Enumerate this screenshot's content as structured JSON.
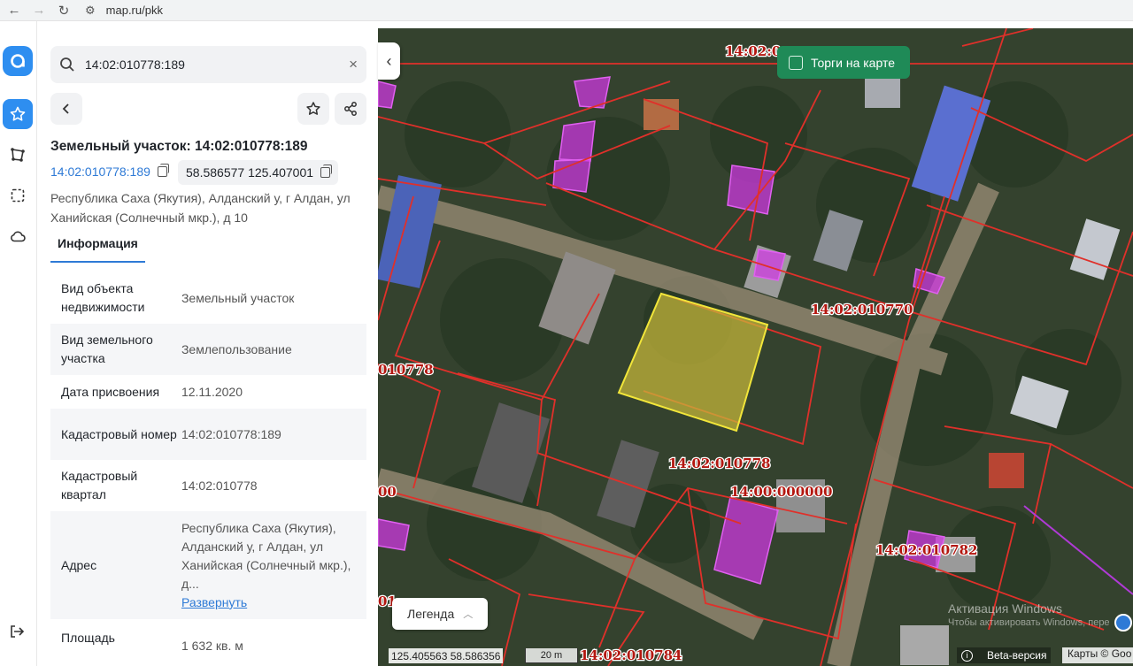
{
  "browser": {
    "url": "map.ru/pkk",
    "back_icon": "arrow-left-icon",
    "forward_icon": "arrow-right-icon",
    "reload_icon": "reload-icon",
    "site_icon": "tune-icon"
  },
  "rail": {
    "items": [
      {
        "name": "logo",
        "icon": "app-logo-icon"
      },
      {
        "name": "favorites",
        "icon": "star-icon"
      },
      {
        "name": "measure",
        "icon": "polygon-icon"
      },
      {
        "name": "select-area",
        "icon": "dashed-square-icon"
      },
      {
        "name": "weather",
        "icon": "cloud-icon"
      },
      {
        "name": "logout",
        "icon": "logout-icon"
      }
    ]
  },
  "search": {
    "value": "14:02:010778:189",
    "placeholder": "",
    "clear_label": "×"
  },
  "object": {
    "title": "Земельный участок: 14:02:010778:189",
    "cadastral_link": "14:02:010778:189",
    "coordinates": "58.586577 125.407001",
    "address_line": "Республика Саха (Якутия), Алданский у, г Алдан, ул Ханийская (Солнечный мкр.), д 10"
  },
  "tabs": [
    {
      "label": "Информация",
      "active": true
    }
  ],
  "info_rows": [
    {
      "label": "Вид объекта недвижимости",
      "value": "Земельный участок"
    },
    {
      "label": "Вид земельного участка",
      "value": "Землепользование"
    },
    {
      "label": "Дата присвоения",
      "value": "12.11.2020"
    },
    {
      "label": "Кадастровый номер",
      "value": "14:02:010778:189"
    },
    {
      "label": "Кадастровый квартал",
      "value": "14:02:010778"
    },
    {
      "label": "Адрес",
      "value": "Республика Саха (Якутия), Алданский у, г Алдан, ул Ханийская (Солнечный мкр.), д...",
      "link": "Развернуть"
    },
    {
      "label": "Площадь",
      "value": "1 632 кв. м"
    }
  ],
  "map": {
    "torgi_label": "Торги на карте",
    "legend_label": "Легенда",
    "coords_readout": "125.405563  58.586356",
    "scale_label": "20 m",
    "beta_label": "Beta-версия",
    "maps_credit": "Карты © Goo",
    "windows_activation": "Активация Windows",
    "windows_activation_sub": "Чтобы активировать Windows, пере",
    "cadastral_labels": [
      "14:02:0",
      "14:02:010770",
      "14:02:010778",
      "14:00:000000",
      "14:02:010782",
      "14:02:010784",
      "010778",
      "00",
      "01"
    ],
    "colors": {
      "boundary": "#e0302a",
      "selected": "#f2e63a",
      "building": "#d238e6",
      "accent": "#2e7ad6"
    }
  }
}
